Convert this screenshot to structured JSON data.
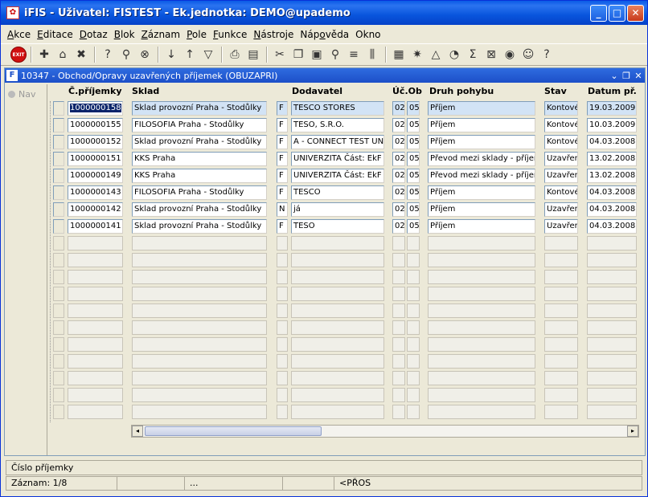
{
  "window": {
    "title": "iFIS - Uživatel: FISTEST - Ek.jednotka: DEMO@upademo"
  },
  "menu": [
    {
      "u": "A",
      "rest": "kce"
    },
    {
      "u": "E",
      "rest": "ditace"
    },
    {
      "u": "D",
      "rest": "otaz"
    },
    {
      "u": "B",
      "rest": "lok"
    },
    {
      "u": "Z",
      "rest": "áznam"
    },
    {
      "u": "P",
      "rest": "ole"
    },
    {
      "u": "F",
      "rest": "unkce"
    },
    {
      "u": "N",
      "rest": "ástroje"
    },
    {
      "pre": "Náp",
      "u": "o",
      "rest": "věda"
    },
    {
      "u": "",
      "rest": "Okno"
    }
  ],
  "toolbar": {
    "exit_label": "EXIT"
  },
  "form": {
    "title": "10347 - Obchod/Opravy uzavřených příjemek (OBUZAPRI)",
    "nav_label": "Nav"
  },
  "columns": {
    "cislo": "Č.příjemky",
    "sklad": "Sklad",
    "dodavatel": "Dodavatel",
    "uc": "Úč.Ob",
    "druh": "Druh pohybu",
    "stav": "Stav",
    "datum": "Datum př."
  },
  "rows": [
    {
      "cislo": "1000000158",
      "sklad": "Sklad provozní Praha - Stodůlky",
      "typ": "F",
      "dodavatel": "TESCO STORES",
      "uc": "02",
      "ob": "05",
      "druh": "Příjem",
      "stav": "Kontové",
      "datum": "19.03.2009"
    },
    {
      "cislo": "1000000155",
      "sklad": "FILOSOFIA Praha - Stodůlky",
      "typ": "F",
      "dodavatel": "TESO, S.R.O.",
      "uc": "02",
      "ob": "05",
      "druh": "Příjem",
      "stav": "Kontové",
      "datum": "10.03.2009"
    },
    {
      "cislo": "1000000152",
      "sklad": "Sklad provozní Praha - Stodůlky",
      "typ": "F",
      "dodavatel": "A - CONNECT TEST UN",
      "uc": "02",
      "ob": "05",
      "druh": "Příjem",
      "stav": "Kontové",
      "datum": "04.03.2008"
    },
    {
      "cislo": "1000000151",
      "sklad": "KKS Praha",
      "typ": "F",
      "dodavatel": "UNIVERZITA Část: EkF",
      "uc": "02",
      "ob": "05",
      "druh": "Převod mezi sklady - příjem",
      "stav": "Uzavřen",
      "datum": "13.02.2008"
    },
    {
      "cislo": "1000000149",
      "sklad": "KKS Praha",
      "typ": "F",
      "dodavatel": "UNIVERZITA Část: EkF",
      "uc": "02",
      "ob": "05",
      "druh": "Převod mezi sklady - příjem",
      "stav": "Uzavřen",
      "datum": "13.02.2008"
    },
    {
      "cislo": "1000000143",
      "sklad": "FILOSOFIA Praha - Stodůlky",
      "typ": "F",
      "dodavatel": "TESCO",
      "uc": "02",
      "ob": "05",
      "druh": "Příjem",
      "stav": "Kontové",
      "datum": "04.03.2008"
    },
    {
      "cislo": "1000000142",
      "sklad": "Sklad provozní Praha - Stodůlky",
      "typ": "N",
      "dodavatel": "já",
      "uc": "02",
      "ob": "05",
      "druh": "Příjem",
      "stav": "Uzavřen",
      "datum": "04.03.2008"
    },
    {
      "cislo": "1000000141",
      "sklad": "Sklad provozní Praha - Stodůlky",
      "typ": "F",
      "dodavatel": " TESO",
      "uc": "02",
      "ob": "05",
      "druh": "Příjem",
      "stav": "Uzavřen",
      "datum": "04.03.2008"
    }
  ],
  "status": {
    "field_hint": "Číslo příjemky",
    "record": "Záznam: 1/8",
    "ellipsis": "...",
    "mode": "<PŘOS"
  }
}
